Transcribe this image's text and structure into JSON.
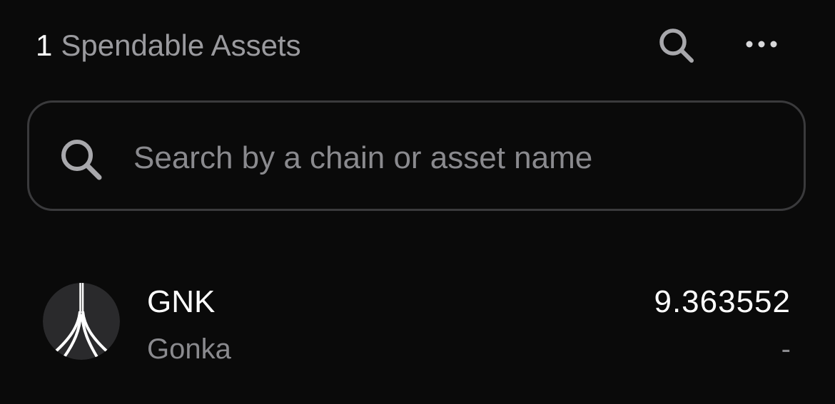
{
  "header": {
    "count": "1",
    "title": "Spendable Assets",
    "search_icon": "search-icon",
    "more_icon": "more-horizontal-icon"
  },
  "search": {
    "placeholder": "Search by a chain or asset name",
    "value": "",
    "icon": "search-icon"
  },
  "assets": [
    {
      "symbol": "GNK",
      "name": "Gonka",
      "balance": "9.363552",
      "fiat_value": "-",
      "logo_icon": "gonka-logo-icon"
    }
  ],
  "colors": {
    "background": "#0a0a0a",
    "primary_text": "#ffffff",
    "secondary_text": "#8a8a8e",
    "border": "#3a3a3c",
    "logo_background": "#2a2a2c"
  }
}
